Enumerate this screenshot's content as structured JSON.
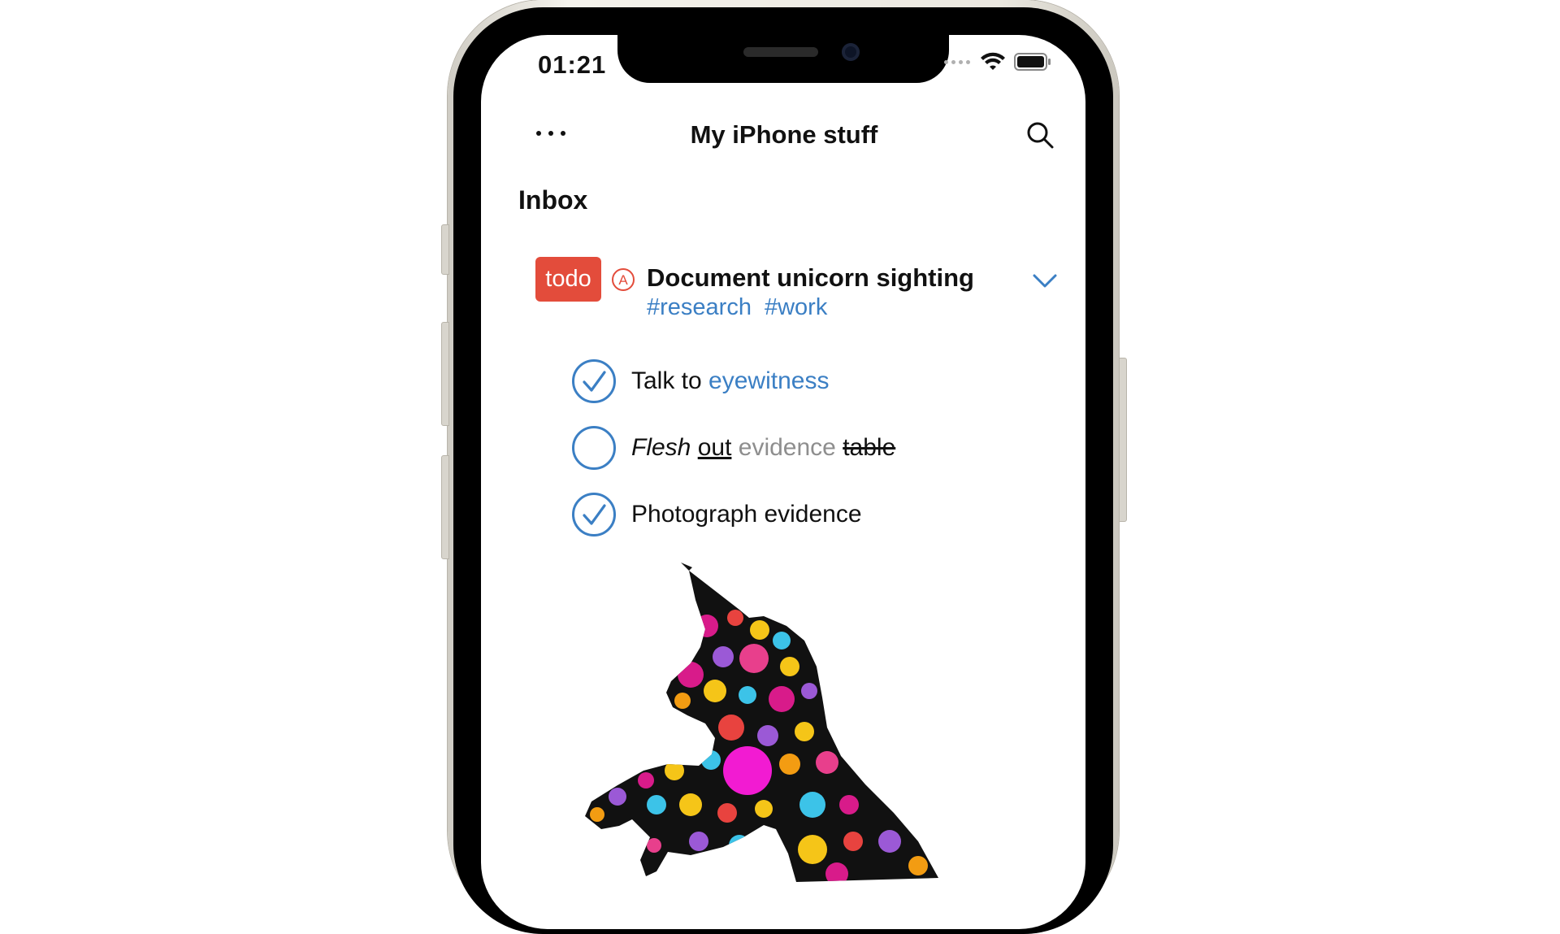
{
  "status_bar": {
    "time": "01:21"
  },
  "header": {
    "title": "My iPhone stuff"
  },
  "section": {
    "title": "Inbox"
  },
  "task": {
    "badge": "todo",
    "priority": "A",
    "title": "Document unicorn sighting",
    "tags": [
      "#research",
      "#work"
    ],
    "subtasks": [
      {
        "parts": [
          "Talk to ",
          "eyewitness"
        ],
        "done": true
      },
      {
        "parts": [
          "Flesh",
          "out",
          "evidence",
          "table"
        ],
        "done": false
      },
      {
        "parts": [
          "Photograph evidence"
        ],
        "done": true
      }
    ]
  },
  "colors": {
    "accent": "#3b7fc4",
    "badge": "#e34c3b",
    "check": "#3b7fc4"
  },
  "icons": [
    "more-icon",
    "search-icon",
    "chevron-down-icon",
    "wifi-icon",
    "battery-icon",
    "check-circle-icon",
    "empty-circle-icon",
    "priority-icon"
  ]
}
